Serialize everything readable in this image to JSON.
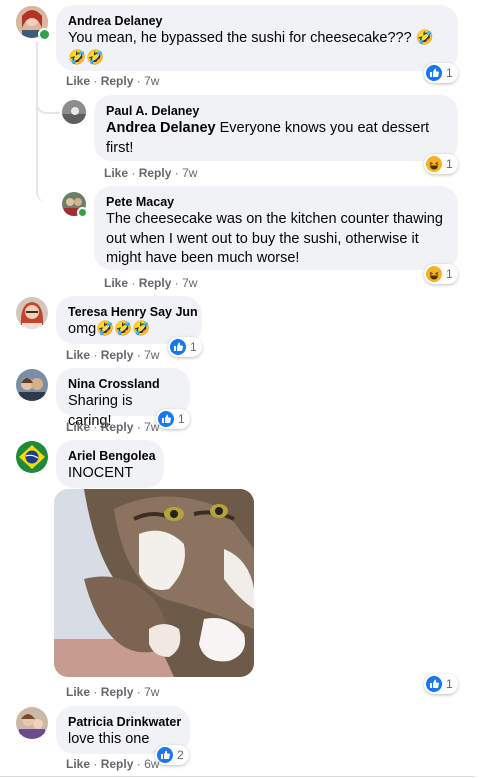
{
  "comments": [
    {
      "author": "Andrea Delaney",
      "text": "You mean, he bypassed the sushi for cheesecake???",
      "like": "Like",
      "reply": "Reply",
      "time": "7w",
      "reaction_count": "1",
      "reaction": "like"
    },
    {
      "author": "Paul A. Delaney",
      "mention": "Andrea Delaney",
      "text": "Everyone knows you eat dessert first!",
      "like": "Like",
      "reply": "Reply",
      "time": "7w",
      "reaction_count": "1",
      "reaction": "haha"
    },
    {
      "author": "Pete Macay",
      "text": "The cheesecake was on the kitchen counter thawing out when I went out to buy the sushi, otherwise it might have been much worse!",
      "like": "Like",
      "reply": "Reply",
      "time": "7w",
      "reaction_count": "1",
      "reaction": "haha"
    },
    {
      "author": "Teresa Henry Say Jun",
      "text": "omg",
      "like": "Like",
      "reply": "Reply",
      "time": "7w",
      "reaction_count": "1",
      "reaction": "like"
    },
    {
      "author": "Nina Crossland",
      "text": "Sharing is caring!",
      "like": "Like",
      "reply": "Reply",
      "time": "7w",
      "reaction_count": "1",
      "reaction": "like"
    },
    {
      "author": "Ariel Bengolea",
      "text": "INOCENT",
      "like": "Like",
      "reply": "Reply",
      "time": "7w",
      "reaction_count": "1",
      "reaction": "like"
    },
    {
      "author": "Patricia Drinkwater",
      "text": "love this one",
      "like": "Like",
      "reply": "Reply",
      "time": "6w",
      "reaction_count": "2",
      "reaction": "like"
    }
  ],
  "colors": {
    "bubble": "#f0f2f5",
    "like_blue": "#1877f2",
    "haha_yellow": "#f7b125",
    "meta_gray": "#65676b",
    "online_green": "#31a24c"
  }
}
